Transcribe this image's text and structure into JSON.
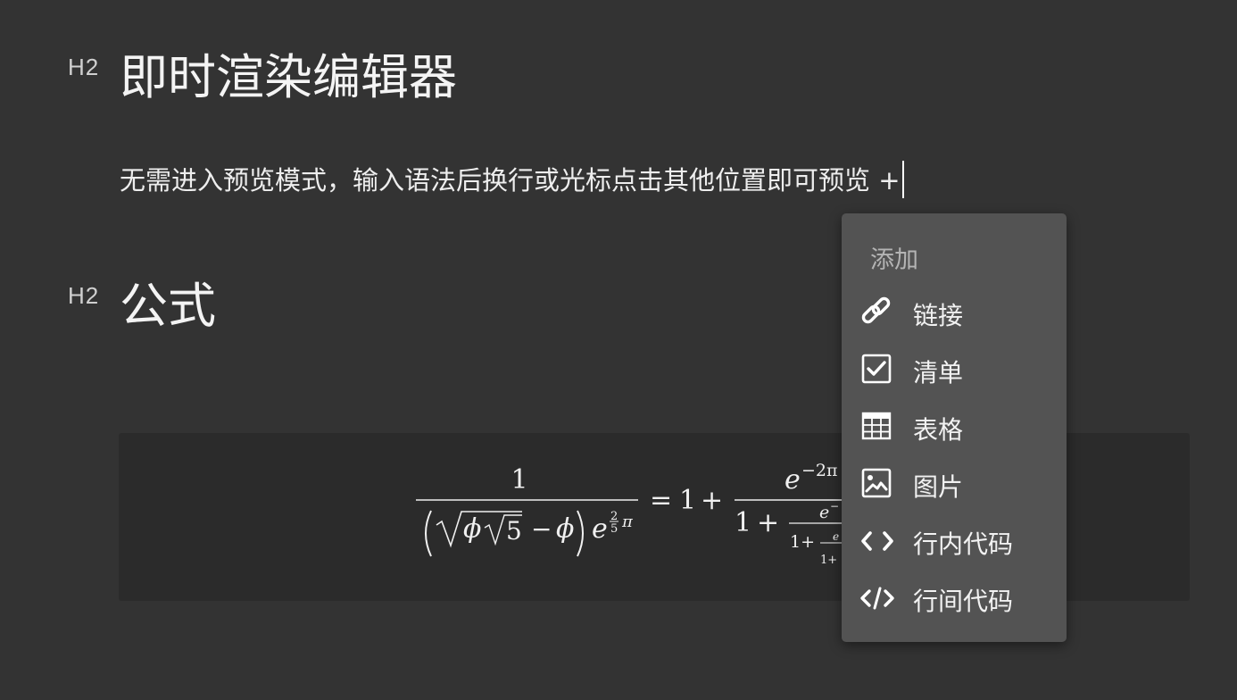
{
  "doc": {
    "heading1": {
      "level": "H2",
      "text": "即时渲染编辑器"
    },
    "paragraph": "无需进入预览模式，输入语法后换行或光标点击其他位置即可预览 +",
    "heading2": {
      "level": "H2",
      "text": "公式"
    }
  },
  "math": {
    "one": "1",
    "two": "2",
    "five": "5",
    "equals": "=",
    "plus": "+",
    "minus": "−",
    "phi": "ϕ",
    "pi": "π",
    "e": "e",
    "neg2pi": "−2π",
    "neg4pi_trunc": "−",
    "one_plus": "1+"
  },
  "menu": {
    "title": "添加",
    "items": [
      {
        "label": "链接",
        "icon": "link-icon"
      },
      {
        "label": "清单",
        "icon": "checklist-icon"
      },
      {
        "label": "表格",
        "icon": "table-icon"
      },
      {
        "label": "图片",
        "icon": "image-icon"
      },
      {
        "label": "行内代码",
        "icon": "inline-code-icon"
      },
      {
        "label": "行间代码",
        "icon": "code-block-icon"
      }
    ]
  },
  "colors": {
    "background": "#333333",
    "menu_background": "#535353",
    "math_block_background": "#2b2b2b",
    "text": "#ececec"
  }
}
